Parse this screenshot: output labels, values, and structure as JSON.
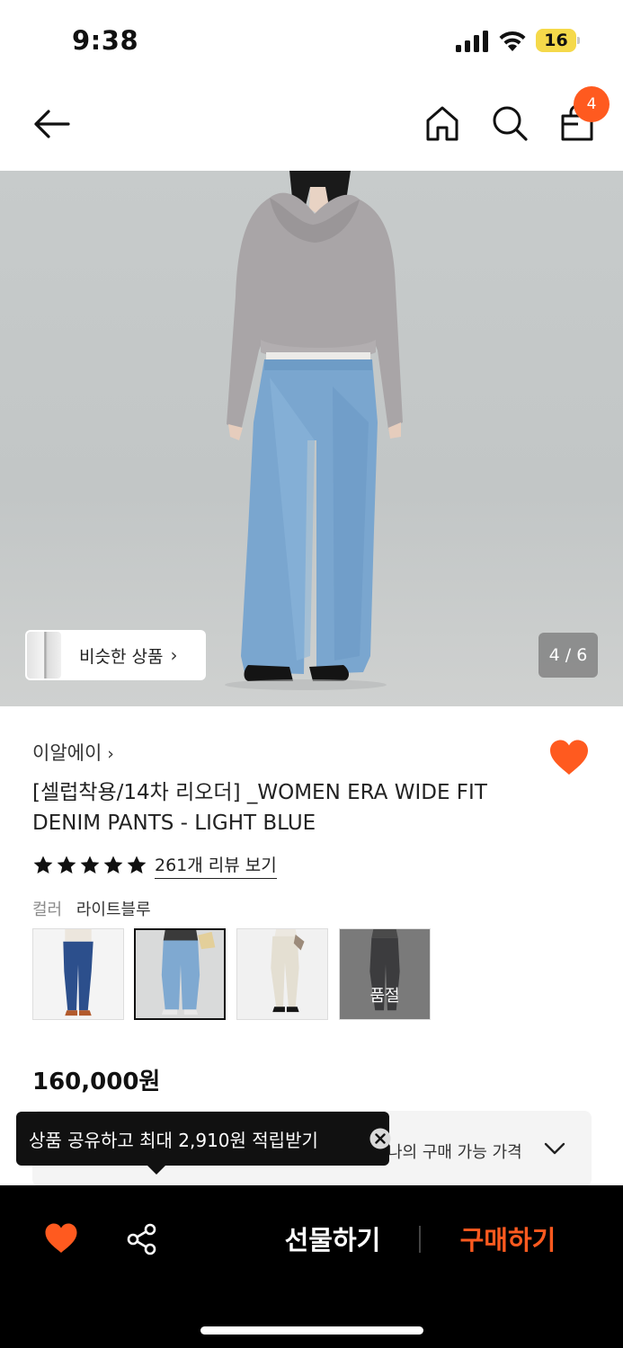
{
  "status_bar": {
    "time": "9:38",
    "battery": "16"
  },
  "nav": {
    "cart_count": "4"
  },
  "gallery": {
    "similar_label": "비슷한 상품",
    "chevron": "›",
    "counter": "4 / 6"
  },
  "product": {
    "brand": "이알에이",
    "brand_chevron": "›",
    "title": "[셀럽착용/14차 리오더] _WOMEN ERA WIDE FIT DENIM PANTS - LIGHT BLUE",
    "rating_stars": 5,
    "review_link": "261개 리뷰 보기",
    "color_label": "컬러",
    "color_value": "라이트블루",
    "swatches": [
      {
        "name": "dark-blue",
        "selected": false,
        "sold_out": false
      },
      {
        "name": "light-blue",
        "selected": true,
        "sold_out": false
      },
      {
        "name": "ivory",
        "selected": false,
        "sold_out": false
      },
      {
        "name": "black",
        "selected": false,
        "sold_out": true,
        "sold_out_label": "품절"
      }
    ],
    "price": "160,000원",
    "my_price_label": "나의 구매 가능 가격"
  },
  "tooltip": {
    "text": "상품 공유하고 최대 2,910원 적립받기"
  },
  "bottom_bar": {
    "gift_label": "선물하기",
    "buy_label": "구매하기"
  },
  "colors": {
    "accent": "#ff5a1f",
    "badge_battery": "#f5d94a"
  },
  "icons": [
    "back-arrow-icon",
    "home-icon",
    "search-icon",
    "cart-icon",
    "heart-icon",
    "share-icon",
    "close-icon",
    "chevron-down-icon",
    "star-icon"
  ]
}
